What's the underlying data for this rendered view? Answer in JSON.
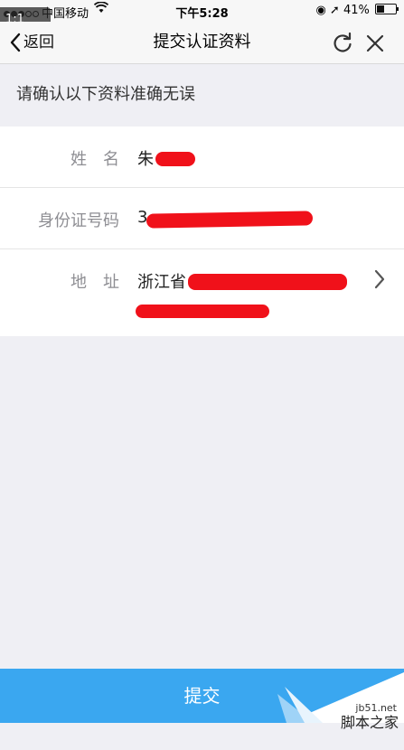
{
  "status_bar": {
    "carrier": "中国移动",
    "time": "下午5:28",
    "battery": "41%"
  },
  "zoom_badge": "1:1",
  "nav": {
    "back_label": "返回",
    "title": "提交认证资料"
  },
  "notice": "请确认以下资料准确无误",
  "form": {
    "name_label": "姓　名",
    "name_value": "朱",
    "id_label": "身份证号码",
    "id_value": "3",
    "address_label": "地　址",
    "address_value": "浙江省"
  },
  "submit_label": "提交",
  "watermark": {
    "domain": "jb51.net",
    "name": "脚本之家"
  },
  "colors": {
    "accent": "#3aa7f0",
    "redaction": "#f0111a"
  },
  "icons": [
    "signal-icon",
    "wifi-icon",
    "location-icon",
    "battery-icon",
    "back-chevron-icon",
    "refresh-icon",
    "close-icon",
    "chevron-right-icon"
  ]
}
